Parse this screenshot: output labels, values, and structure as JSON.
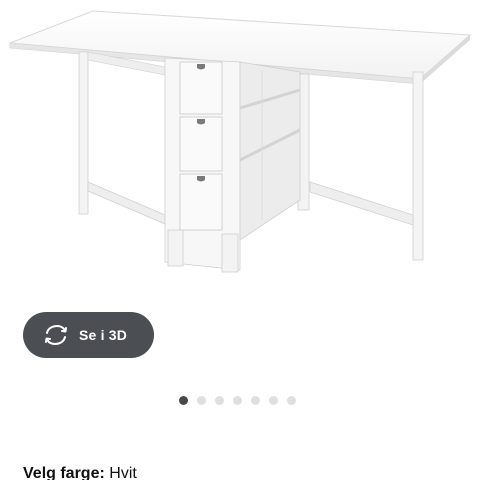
{
  "product": {
    "image_alt": "NORDEN gateleg table with drawers, white",
    "view_3d_label": "Se i 3D",
    "view_3d_icon": "rotate-3d-icon"
  },
  "carousel": {
    "total": 7,
    "active": 1
  },
  "color": {
    "label": "Velg farge:",
    "value": "Hvit"
  },
  "colors": {
    "button_bg": "#4b4f53",
    "dot_active": "#484848",
    "dot_inactive": "#dfdfdf"
  }
}
